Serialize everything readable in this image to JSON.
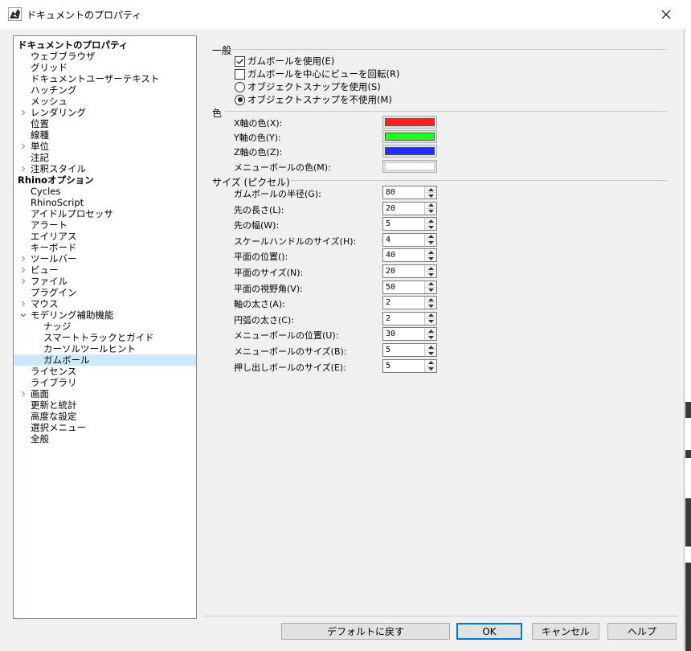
{
  "window": {
    "title": "ドキュメントのプロパティ"
  },
  "tree": {
    "items": [
      {
        "label": "ドキュメントのプロパティ",
        "level": 0,
        "bold": true,
        "expander": "",
        "selected": false
      },
      {
        "label": "ウェブブラウザ",
        "level": 1,
        "bold": false,
        "expander": "",
        "selected": false
      },
      {
        "label": "グリッド",
        "level": 1,
        "bold": false,
        "expander": "",
        "selected": false
      },
      {
        "label": "ドキュメントユーザーテキスト",
        "level": 1,
        "bold": false,
        "expander": "",
        "selected": false
      },
      {
        "label": "ハッチング",
        "level": 1,
        "bold": false,
        "expander": "",
        "selected": false
      },
      {
        "label": "メッシュ",
        "level": 1,
        "bold": false,
        "expander": "",
        "selected": false
      },
      {
        "label": "レンダリング",
        "level": 1,
        "bold": false,
        "expander": "collapsed",
        "selected": false
      },
      {
        "label": "位置",
        "level": 1,
        "bold": false,
        "expander": "",
        "selected": false
      },
      {
        "label": "線種",
        "level": 1,
        "bold": false,
        "expander": "",
        "selected": false
      },
      {
        "label": "単位",
        "level": 1,
        "bold": false,
        "expander": "collapsed",
        "selected": false
      },
      {
        "label": "注記",
        "level": 1,
        "bold": false,
        "expander": "",
        "selected": false
      },
      {
        "label": "注釈スタイル",
        "level": 1,
        "bold": false,
        "expander": "collapsed",
        "selected": false
      },
      {
        "label": "Rhinoオプション",
        "level": 0,
        "bold": true,
        "expander": "",
        "selected": false
      },
      {
        "label": "Cycles",
        "level": 1,
        "bold": false,
        "expander": "",
        "selected": false
      },
      {
        "label": "RhinoScript",
        "level": 1,
        "bold": false,
        "expander": "",
        "selected": false
      },
      {
        "label": "アイドルプロセッサ",
        "level": 1,
        "bold": false,
        "expander": "",
        "selected": false
      },
      {
        "label": "アラート",
        "level": 1,
        "bold": false,
        "expander": "",
        "selected": false
      },
      {
        "label": "エイリアス",
        "level": 1,
        "bold": false,
        "expander": "",
        "selected": false
      },
      {
        "label": "キーボード",
        "level": 1,
        "bold": false,
        "expander": "",
        "selected": false
      },
      {
        "label": "ツールバー",
        "level": 1,
        "bold": false,
        "expander": "collapsed",
        "selected": false
      },
      {
        "label": "ビュー",
        "level": 1,
        "bold": false,
        "expander": "collapsed",
        "selected": false
      },
      {
        "label": "ファイル",
        "level": 1,
        "bold": false,
        "expander": "collapsed",
        "selected": false
      },
      {
        "label": "プラグイン",
        "level": 1,
        "bold": false,
        "expander": "",
        "selected": false
      },
      {
        "label": "マウス",
        "level": 1,
        "bold": false,
        "expander": "collapsed",
        "selected": false
      },
      {
        "label": "モデリング補助機能",
        "level": 1,
        "bold": false,
        "expander": "expanded",
        "selected": false
      },
      {
        "label": "ナッジ",
        "level": 2,
        "bold": false,
        "expander": "",
        "selected": false
      },
      {
        "label": "スマートトラックとガイド",
        "level": 2,
        "bold": false,
        "expander": "",
        "selected": false
      },
      {
        "label": "カーソルツールヒント",
        "level": 2,
        "bold": false,
        "expander": "",
        "selected": false
      },
      {
        "label": "ガムボール",
        "level": 2,
        "bold": false,
        "expander": "",
        "selected": true
      },
      {
        "label": "ライセンス",
        "level": 1,
        "bold": false,
        "expander": "",
        "selected": false
      },
      {
        "label": "ライブラリ",
        "level": 1,
        "bold": false,
        "expander": "",
        "selected": false
      },
      {
        "label": "画面",
        "level": 1,
        "bold": false,
        "expander": "collapsed",
        "selected": false
      },
      {
        "label": "更新と統計",
        "level": 1,
        "bold": false,
        "expander": "",
        "selected": false
      },
      {
        "label": "高度な設定",
        "level": 1,
        "bold": false,
        "expander": "",
        "selected": false
      },
      {
        "label": "選択メニュー",
        "level": 1,
        "bold": false,
        "expander": "",
        "selected": false
      },
      {
        "label": "全般",
        "level": 1,
        "bold": false,
        "expander": "",
        "selected": false
      }
    ]
  },
  "general": {
    "title": "一般",
    "use_gumball": {
      "label": "ガムボールを使用(E)",
      "checked": true
    },
    "rotate_view": {
      "label": "ガムボールを中心にビューを回転(R)",
      "checked": false
    },
    "use_osnap": {
      "label": "オブジェクトスナップを使用(S)",
      "selected": false
    },
    "no_osnap": {
      "label": "オブジェクトスナップを不使用(M)",
      "selected": true
    }
  },
  "colors": {
    "title": "色",
    "items": [
      {
        "label": "X軸の色(X):",
        "color": "#ff1f1f"
      },
      {
        "label": "Y軸の色(Y):",
        "color": "#1fff1f"
      },
      {
        "label": "Z軸の色(Z):",
        "color": "#1f2fff"
      },
      {
        "label": "メニューボールの色(M):",
        "color": "#ffffff"
      }
    ]
  },
  "sizes": {
    "title": "サイズ (ピクセル)",
    "items": [
      {
        "label": "ガムボールの半径(G):",
        "value": "80"
      },
      {
        "label": "先の長さ(L):",
        "value": "20"
      },
      {
        "label": "先の幅(W):",
        "value": "5"
      },
      {
        "label": "スケールハンドルのサイズ(H):",
        "value": "4"
      },
      {
        "label": "平面の位置():",
        "value": "40"
      },
      {
        "label": "平面のサイズ(N):",
        "value": "20"
      },
      {
        "label": "平面の視野角(V):",
        "value": "50"
      },
      {
        "label": "軸の太さ(A):",
        "value": "2"
      },
      {
        "label": "円弧の太さ(C):",
        "value": "2"
      },
      {
        "label": "メニューボールの位置(U):",
        "value": "30"
      },
      {
        "label": "メニューボールのサイズ(B):",
        "value": "5"
      },
      {
        "label": "押し出しボールのサイズ(E):",
        "value": "5"
      }
    ]
  },
  "buttons": {
    "default_label": "デフォルトに戻す",
    "ok_label": "OK",
    "cancel_label": "キャンセル",
    "help_label": "ヘルプ"
  }
}
